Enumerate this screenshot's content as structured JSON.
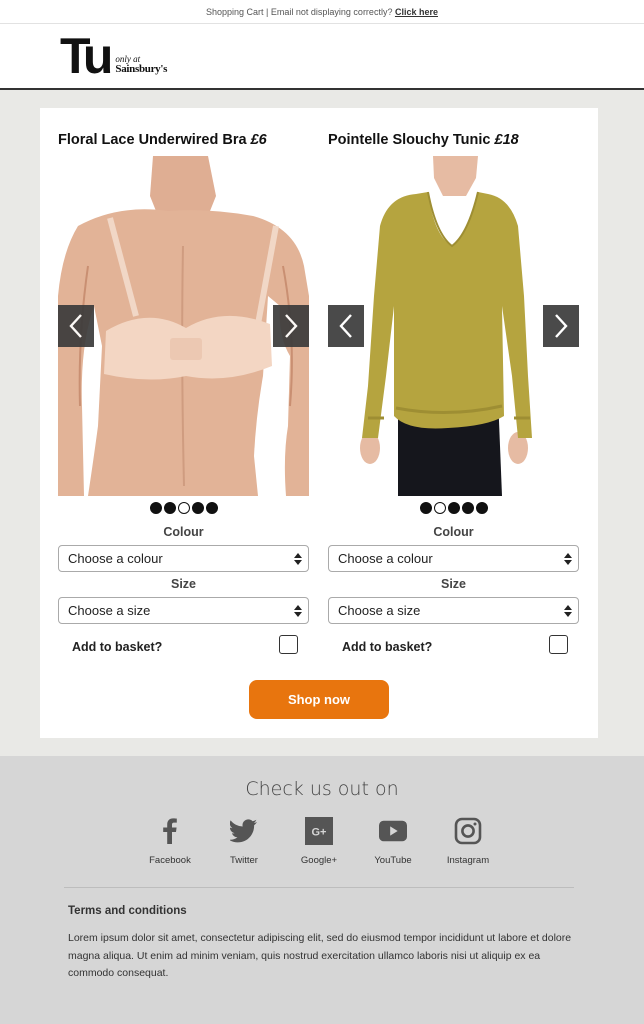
{
  "topbar": {
    "text": "Shopping Cart | Email not displaying correctly? ",
    "link": "Click here"
  },
  "header": {
    "logo_main": "Tu",
    "logo_only": "only at",
    "logo_brand": "Sainsbury's"
  },
  "products": [
    {
      "name": "Floral Lace Underwired Bra ",
      "price": "£6",
      "colour_label": "Colour",
      "colour_value": "Choose a colour",
      "size_label": "Size",
      "size_value": "Choose a size",
      "basket_label": "Add to basket?",
      "carousel_dots": [
        true,
        true,
        false,
        true,
        true
      ]
    },
    {
      "name": "Pointelle Slouchy Tunic ",
      "price": "£18",
      "colour_label": "Colour",
      "colour_value": "Choose a colour",
      "size_label": "Size",
      "size_value": "Choose a size",
      "basket_label": "Add to basket?",
      "carousel_dots": [
        true,
        false,
        true,
        true,
        true
      ]
    }
  ],
  "cta": {
    "label": "Shop now",
    "color": "#e8750e"
  },
  "footer": {
    "heading": "Check us out on",
    "socials": [
      {
        "label": "Facebook",
        "icon": "facebook-icon"
      },
      {
        "label": "Twitter",
        "icon": "twitter-icon"
      },
      {
        "label": "Google+",
        "icon": "google-plus-icon"
      },
      {
        "label": "YouTube",
        "icon": "youtube-icon"
      },
      {
        "label": "Instagram",
        "icon": "instagram-icon"
      }
    ],
    "terms_title": "Terms and conditions",
    "terms_text": "Lorem ipsum dolor sit amet, consectetur adipiscing elit, sed do eiusmod tempor incididunt ut labore et dolore magna aliqua. Ut enim ad minim veniam, quis nostrud exercitation ullamco laboris nisi ut aliquip ex ea commodo consequat."
  }
}
